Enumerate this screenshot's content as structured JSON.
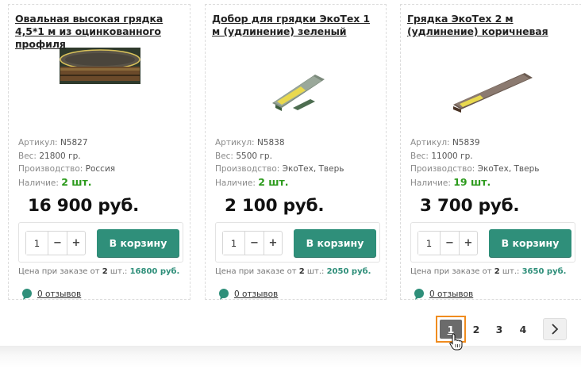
{
  "currency_suffix": "руб.",
  "labels": {
    "article": "Артикул:",
    "weight": "Вес:",
    "maker": "Производство:",
    "stock": "Наличие:",
    "bulk_prefix": "Цена при заказе от",
    "bulk_qty": "2",
    "bulk_unit": "шт.:",
    "cart_button": "В корзину",
    "reviews": "0 отзывов",
    "minus": "−",
    "plus": "+"
  },
  "products": [
    {
      "title": "Овальная высокая грядка 4,5*1 м из оцинкованного профиля",
      "image_icon": "oval-garden-bed-image",
      "article": "N5827",
      "weight": "21800 гр.",
      "maker": "Россия",
      "stock": "2 шт.",
      "price": "16 900 руб.",
      "qty": "1",
      "bulk_price": "16800 руб."
    },
    {
      "title": "Добор для грядки ЭкоТех 1 м (удлинение) зеленый",
      "image_icon": "green-bed-extension-image",
      "article": "N5838",
      "weight": "5500 гр.",
      "maker": "ЭкоТех, Тверь",
      "stock": "2 шт.",
      "price": "2 100 руб.",
      "qty": "1",
      "bulk_price": "2050 руб."
    },
    {
      "title": "Грядка ЭкоТех 2 м (удлинение) коричневая",
      "image_icon": "brown-bed-image",
      "article": "N5839",
      "weight": "11000 гр.",
      "maker": "ЭкоТех, Тверь",
      "stock": "19 шт.",
      "price": "3 700 руб.",
      "qty": "1",
      "bulk_price": "3650 руб."
    }
  ],
  "pagination": {
    "pages": [
      "1",
      "2",
      "3",
      "4"
    ],
    "current": "1",
    "next_icon": "chevron-right-icon"
  },
  "colors": {
    "accent": "#2f8f7a",
    "stock": "#2b9a1b",
    "active_page": "#6b6b6b",
    "focus_ring": "#f08c1f"
  }
}
